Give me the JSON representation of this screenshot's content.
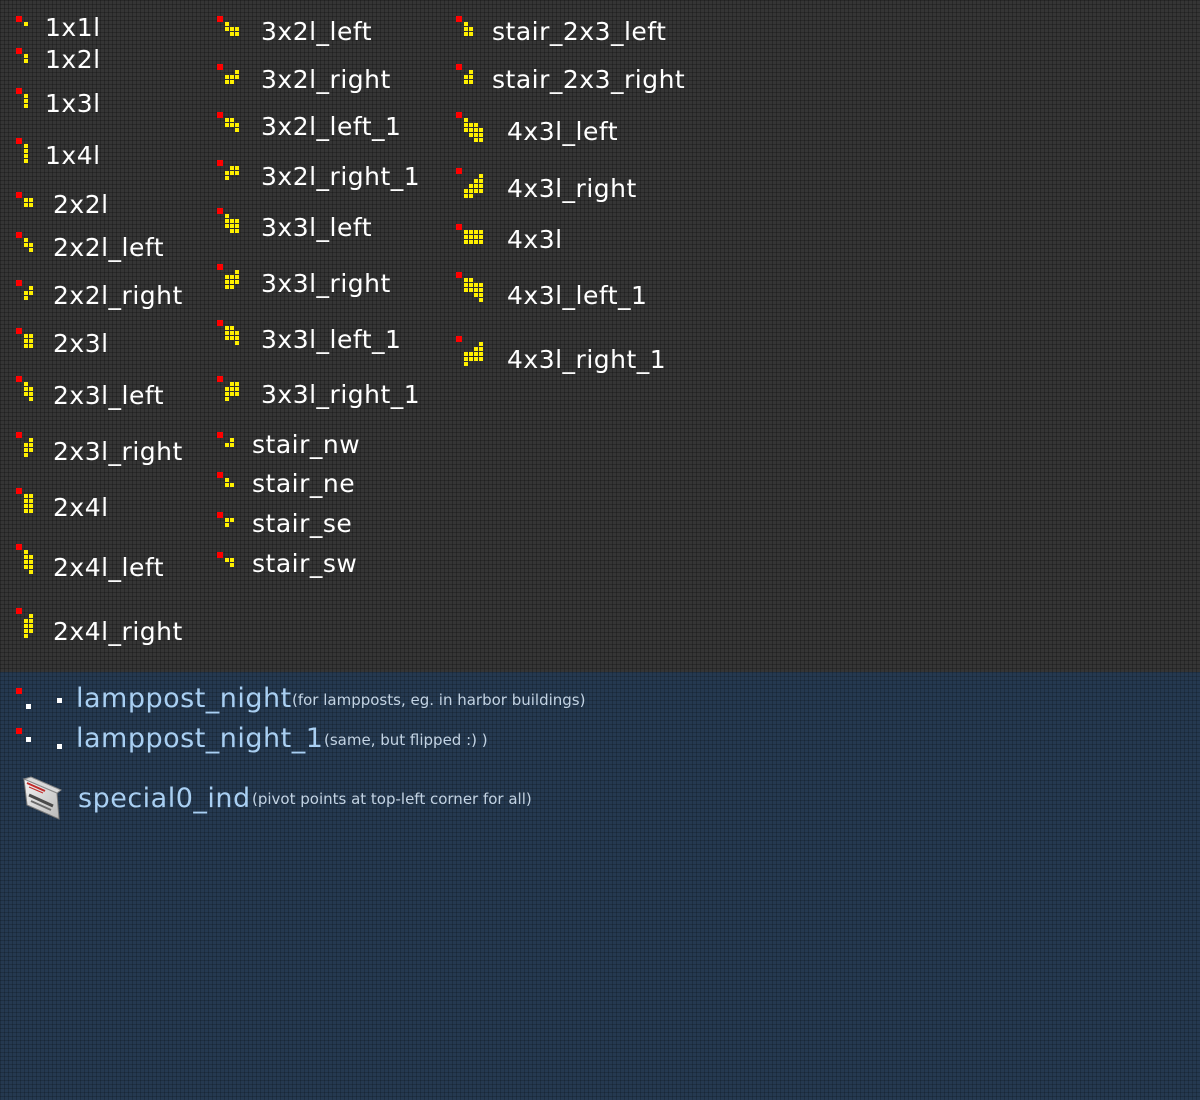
{
  "colors": {
    "pivot": "#ff0000",
    "cell": "#fff000",
    "lamp": "#ffffff"
  },
  "tiles": [
    {
      "name": "1x1l",
      "label": "1x1l",
      "shape": [
        "X"
      ]
    },
    {
      "name": "1x2l",
      "label": "1x2l",
      "shape": [
        "X",
        "X"
      ]
    },
    {
      "name": "1x3l",
      "label": "1x3l",
      "shape": [
        "X",
        "X",
        "X"
      ]
    },
    {
      "name": "1x4l",
      "label": "1x4l",
      "shape": [
        "X",
        "X",
        "X",
        "X"
      ]
    },
    {
      "name": "2x2l",
      "label": "2x2l",
      "shape": [
        "XX",
        "XX"
      ]
    },
    {
      "name": "2x2l_left",
      "label": "2x2l_left",
      "shape": [
        "X.",
        "XX",
        ".X"
      ]
    },
    {
      "name": "2x2l_right",
      "label": "2x2l_right",
      "shape": [
        ".X",
        "XX",
        "X."
      ]
    },
    {
      "name": "2x3l",
      "label": "2x3l",
      "shape": [
        "XX",
        "XX",
        "XX"
      ]
    },
    {
      "name": "2x3l_left",
      "label": "2x3l_left",
      "shape": [
        "X.",
        "XX",
        "XX",
        ".X"
      ]
    },
    {
      "name": "2x3l_right",
      "label": "2x3l_right",
      "shape": [
        ".X",
        "XX",
        "XX",
        "X."
      ]
    },
    {
      "name": "2x4l",
      "label": "2x4l",
      "shape": [
        "XX",
        "XX",
        "XX",
        "XX"
      ]
    },
    {
      "name": "2x4l_left",
      "label": "2x4l_left",
      "shape": [
        "X.",
        "XX",
        "XX",
        "XX",
        ".X"
      ]
    },
    {
      "name": "2x4l_right",
      "label": "2x4l_right",
      "shape": [
        ".X",
        "XX",
        "XX",
        "XX",
        "X."
      ]
    },
    {
      "name": "3x2l_left",
      "label": "3x2l_left",
      "shape": [
        "X..",
        "XXX",
        ".XX"
      ]
    },
    {
      "name": "3x2l_right",
      "label": "3x2l_right",
      "shape": [
        "..X",
        "XXX",
        "XX."
      ]
    },
    {
      "name": "3x2l_left_1",
      "label": "3x2l_left_1",
      "shape": [
        "XX.",
        "XXX",
        "..X"
      ]
    },
    {
      "name": "3x2l_right_1",
      "label": "3x2l_right_1",
      "shape": [
        ".XX",
        "XXX",
        "X.."
      ]
    },
    {
      "name": "3x3l_left",
      "label": "3x3l_left",
      "shape": [
        "X..",
        "XXX",
        "XXX",
        ".XX"
      ]
    },
    {
      "name": "3x3l_right",
      "label": "3x3l_right",
      "shape": [
        "..X",
        "XXX",
        "XXX",
        "XX."
      ]
    },
    {
      "name": "3x3l_left_1",
      "label": "3x3l_left_1",
      "shape": [
        "XX.",
        "XXX",
        "XXX",
        "..X"
      ]
    },
    {
      "name": "3x3l_right_1",
      "label": "3x3l_right_1",
      "shape": [
        ".XX",
        "XXX",
        "XXX",
        "X.."
      ]
    },
    {
      "name": "stair_nw",
      "label": "stair_nw",
      "shape": [
        ".X",
        "XX"
      ]
    },
    {
      "name": "stair_ne",
      "label": "stair_ne",
      "shape": [
        "X.",
        "XX"
      ]
    },
    {
      "name": "stair_se",
      "label": "stair_se",
      "shape": [
        "XX",
        "X."
      ]
    },
    {
      "name": "stair_sw",
      "label": "stair_sw",
      "shape": [
        "XX",
        ".X"
      ]
    },
    {
      "name": "stair_2x3_left",
      "label": "stair_2x3_left",
      "shape": [
        "X.",
        "XX",
        "XX"
      ]
    },
    {
      "name": "stair_2x3_right",
      "label": "stair_2x3_right",
      "shape": [
        ".X",
        "XX",
        "XX"
      ]
    },
    {
      "name": "4x3l_left",
      "label": "4x3l_left",
      "shape": [
        "X...",
        "XXX.",
        "XXXX",
        ".XXX",
        "..XX"
      ]
    },
    {
      "name": "4x3l_right",
      "label": "4x3l_right",
      "shape": [
        "...X",
        "..XX",
        ".XXX",
        "XXXX",
        "XX.."
      ]
    },
    {
      "name": "4x3l",
      "label": "4x3l",
      "shape": [
        "XXXX",
        "XXXX",
        "XXXX"
      ]
    },
    {
      "name": "4x3l_left_1",
      "label": "4x3l_left_1",
      "shape": [
        "XX..",
        "XXXX",
        "XXXX",
        "..XX",
        "...X"
      ]
    },
    {
      "name": "4x3l_right_1",
      "label": "4x3l_right_1",
      "shape": [
        "...X",
        "..XX",
        "XXXX",
        "XXXX",
        "X..."
      ]
    }
  ],
  "specials": [
    {
      "name": "lamppost_night",
      "label": "lamppost_night",
      "note": "(for lampposts, eg. in harbor buildings)"
    },
    {
      "name": "lamppost_night_1",
      "label": "lamppost_night_1",
      "note": "(same, but flipped :) )"
    },
    {
      "name": "special0_ind",
      "label": "special0_ind",
      "note": "(pivot points at top-left corner for all)"
    }
  ]
}
